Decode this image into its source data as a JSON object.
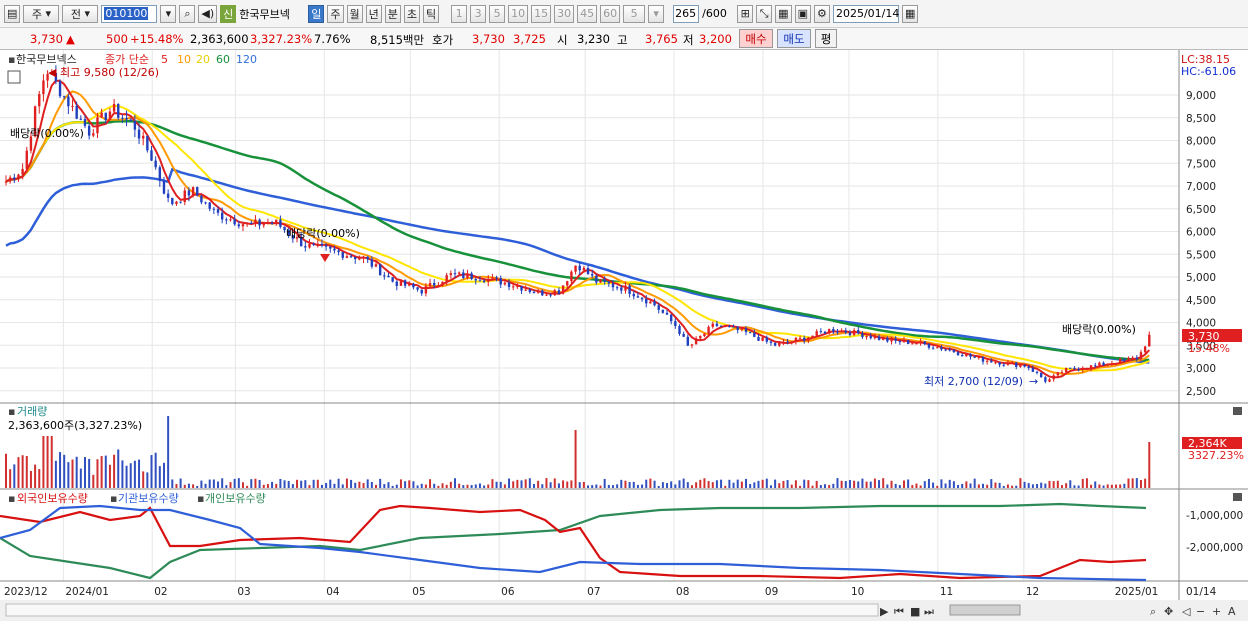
{
  "toolbar": {
    "period_select": "주",
    "prev_label": "전",
    "stock_code": "010100",
    "shin_badge": "신",
    "stock_name": "한국무브넥",
    "periods": [
      "일",
      "주",
      "월",
      "년",
      "분",
      "초",
      "틱"
    ],
    "active_period": "일",
    "intervals": [
      "1",
      "3",
      "5",
      "10",
      "15",
      "30",
      "45",
      "60"
    ],
    "interval_value": "5",
    "count_current": "265",
    "count_total": "/600",
    "date": "2025/01/14"
  },
  "quote": {
    "price": "3,730",
    "change_arrow": "▲",
    "change": "500",
    "change_pct": "+15.48%",
    "volume": "2,363,600",
    "volume_pct": "3,327.23%",
    "turnover_rate": "7.76%",
    "amount": "8,515백만",
    "hoga_label": "호가",
    "ask": "3,730",
    "bid": "3,725",
    "open_label": "시",
    "open": "3,230",
    "high_label": "고",
    "high": "3,765",
    "low_label": "저",
    "low": "3,200",
    "buy_label": "매수",
    "sell_label": "매도",
    "eval_label": "평"
  },
  "price_panel": {
    "stock_name": "한국무브넥스",
    "ma_prefix": "종가 단순",
    "ma_periods": [
      "5",
      "10",
      "20",
      "60",
      "120"
    ],
    "ma_colors": [
      "#e02020",
      "#ff9a00",
      "#ffe600",
      "#17913a",
      "#2f5fd8"
    ],
    "lc": "LC:38.15",
    "hc": "HC:-61.06",
    "high_annotation": "최고 9,580 (12/26)",
    "low_annotation": "최저 2,700 (12/09)",
    "dividend_label": "배당락(0.00%)",
    "current_price_tag": "3,730",
    "current_pct_tag": "15.48%"
  },
  "volume_panel": {
    "title": "거래량",
    "current": "2,363,600주(3,327.23%)",
    "tag_value": "2,364K",
    "tag_pct": "3327.23%"
  },
  "holdings_panel": {
    "series": [
      "외국인보유수량",
      "기관보유수량",
      "개인보유수량"
    ],
    "series_colors": [
      "#d81010",
      "#2f5fd8",
      "#2e8b57"
    ],
    "axis_labels": [
      "-1,000,000",
      "-2,000,000"
    ]
  },
  "x_axis": {
    "labels": [
      "2023/12",
      "2024/01",
      "02",
      "03",
      "04",
      "05",
      "06",
      "07",
      "08",
      "09",
      "10",
      "11",
      "12",
      "2025/01"
    ],
    "right_label": "01/14"
  },
  "chart_data": {
    "type": "candlestick",
    "title": "한국무브넥스",
    "y_ticks": [
      9000,
      8500,
      8000,
      7500,
      7000,
      6500,
      6000,
      5500,
      5000,
      4500,
      4000,
      3500,
      3000,
      2500
    ],
    "ylim": [
      2300,
      9700
    ],
    "x_start": "2023/12",
    "x_end": "2025/01/14",
    "close_path": [
      [
        "2023-12-12",
        7100
      ],
      [
        "2023-12-18",
        7400
      ],
      [
        "2023-12-22",
        8600
      ],
      [
        "2023-12-26",
        9580
      ],
      [
        "2024-01-02",
        8900
      ],
      [
        "2024-01-10",
        8200
      ],
      [
        "2024-01-18",
        8700
      ],
      [
        "2024-01-26",
        8300
      ],
      [
        "2024-02-01",
        7600
      ],
      [
        "2024-02-07",
        6600
      ],
      [
        "2024-02-15",
        6900
      ],
      [
        "2024-02-23",
        6400
      ],
      [
        "2024-03-05",
        6150
      ],
      [
        "2024-03-15",
        6200
      ],
      [
        "2024-03-25",
        5700
      ],
      [
        "2024-04-05",
        5550
      ],
      [
        "2024-04-15",
        5400
      ],
      [
        "2024-04-25",
        4900
      ],
      [
        "2024-05-05",
        4700
      ],
      [
        "2024-05-15",
        5050
      ],
      [
        "2024-05-25",
        5000
      ],
      [
        "2024-06-05",
        4850
      ],
      [
        "2024-06-15",
        4650
      ],
      [
        "2024-06-22",
        4700
      ],
      [
        "2024-06-28",
        5300
      ],
      [
        "2024-07-05",
        4900
      ],
      [
        "2024-07-15",
        4750
      ],
      [
        "2024-07-25",
        4400
      ],
      [
        "2024-08-02",
        3900
      ],
      [
        "2024-08-06",
        3450
      ],
      [
        "2024-08-15",
        3950
      ],
      [
        "2024-08-25",
        3800
      ],
      [
        "2024-09-05",
        3500
      ],
      [
        "2024-09-15",
        3650
      ],
      [
        "2024-09-25",
        3850
      ],
      [
        "2024-10-05",
        3750
      ],
      [
        "2024-10-15",
        3600
      ],
      [
        "2024-10-25",
        3550
      ],
      [
        "2024-11-05",
        3400
      ],
      [
        "2024-11-15",
        3200
      ],
      [
        "2024-11-25",
        3100
      ],
      [
        "2024-12-02",
        3050
      ],
      [
        "2024-12-09",
        2700
      ],
      [
        "2024-12-15",
        2950
      ],
      [
        "2024-12-26",
        3050
      ],
      [
        "2025-01-03",
        3150
      ],
      [
        "2025-01-10",
        3230
      ],
      [
        "2025-01-14",
        3730
      ]
    ],
    "volume_peaks": [
      [
        "2023-12-26",
        "high"
      ],
      [
        "2024-02-07",
        "high"
      ],
      [
        "2024-06-28",
        "high"
      ],
      [
        "2025-01-14",
        "2,363,600"
      ]
    ]
  }
}
